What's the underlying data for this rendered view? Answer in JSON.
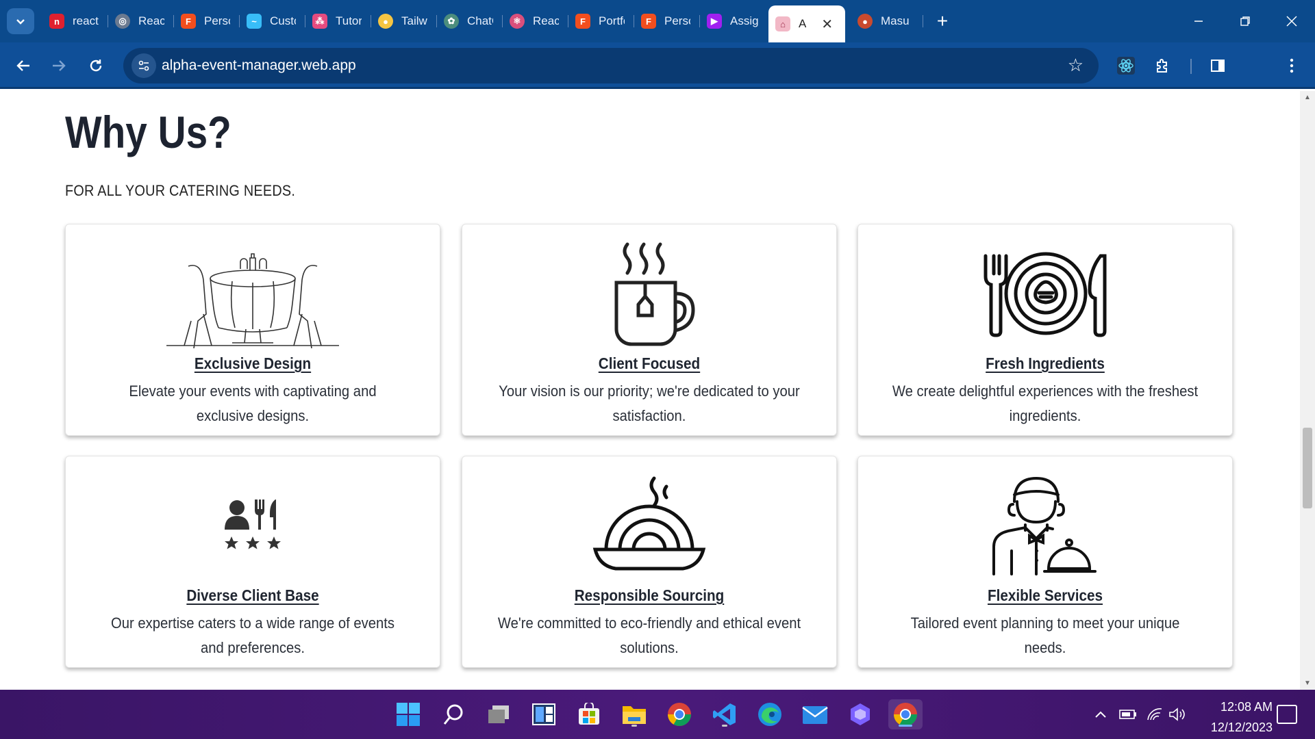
{
  "browser": {
    "tabs": [
      {
        "label": "react-",
        "favicon_color": "#e0202f",
        "favicon_char": "n"
      },
      {
        "label": "React",
        "favicon_color": "#6b7a90",
        "favicon_char": "◎"
      },
      {
        "label": "Perso",
        "favicon_color": "#f24e1e",
        "favicon_char": "F"
      },
      {
        "label": "Custo",
        "favicon_color": "#38bdf8",
        "favicon_char": "~"
      },
      {
        "label": "Tutori",
        "favicon_color": "#e54b7f",
        "favicon_char": "⁂"
      },
      {
        "label": "Tailwi",
        "favicon_color": "#f5c542",
        "favicon_char": "●"
      },
      {
        "label": "ChatG",
        "favicon_color": "#4c8d7d",
        "favicon_char": "✿"
      },
      {
        "label": "React",
        "favicon_color": "#d94f7c",
        "favicon_char": "⚛"
      },
      {
        "label": "Portfo",
        "favicon_color": "#f24e1e",
        "favicon_char": "F"
      },
      {
        "label": "Perso",
        "favicon_color": "#f24e1e",
        "favicon_char": "F"
      },
      {
        "label": "Assig",
        "favicon_color": "#a020f0",
        "favicon_char": "▶"
      },
      {
        "label": "A",
        "favicon_color": "#f2b8c6",
        "favicon_char": "⌂",
        "active": true
      },
      {
        "label": "Masu",
        "favicon_color": "#c94a2e",
        "favicon_char": "●"
      }
    ],
    "url": "alpha-event-manager.web.app",
    "colors": {
      "tabbar": "#0b4a8c",
      "toolbar": "#0f4f98"
    }
  },
  "page": {
    "title": "Why Us?",
    "subtitle": "FOR ALL YOUR CATERING NEEDS.",
    "features": [
      {
        "icon": "dining-table-icon",
        "title": "Exclusive Design",
        "desc": "Elevate your events with captivating and exclusive designs."
      },
      {
        "icon": "coffee-mug-icon",
        "title": "Client Focused",
        "desc": "Your vision is our priority; we're dedicated to your satisfaction."
      },
      {
        "icon": "plate-cutlery-icon",
        "title": "Fresh Ingredients",
        "desc": "We create delightful experiences with the freshest ingredients."
      },
      {
        "icon": "diverse-clients-icon",
        "title": "Diverse Client Base",
        "desc": "Our expertise caters to a wide range of events and preferences."
      },
      {
        "icon": "noodle-bowl-icon",
        "title": "Responsible Sourcing",
        "desc": "We're committed to eco-friendly and ethical event solutions."
      },
      {
        "icon": "waiter-cloche-icon",
        "title": "Flexible Services",
        "desc": "Tailored event planning to meet your unique needs."
      }
    ]
  },
  "taskbar": {
    "time": "12:08 AM",
    "date": "12/12/2023",
    "apps": [
      "start-icon",
      "search-icon",
      "task-view-icon",
      "widgets-icon",
      "store-icon",
      "file-explorer-icon",
      "chrome-icon",
      "vscode-icon",
      "edge-icon",
      "mail-icon",
      "copilot-icon",
      "chrome-active-icon"
    ]
  }
}
